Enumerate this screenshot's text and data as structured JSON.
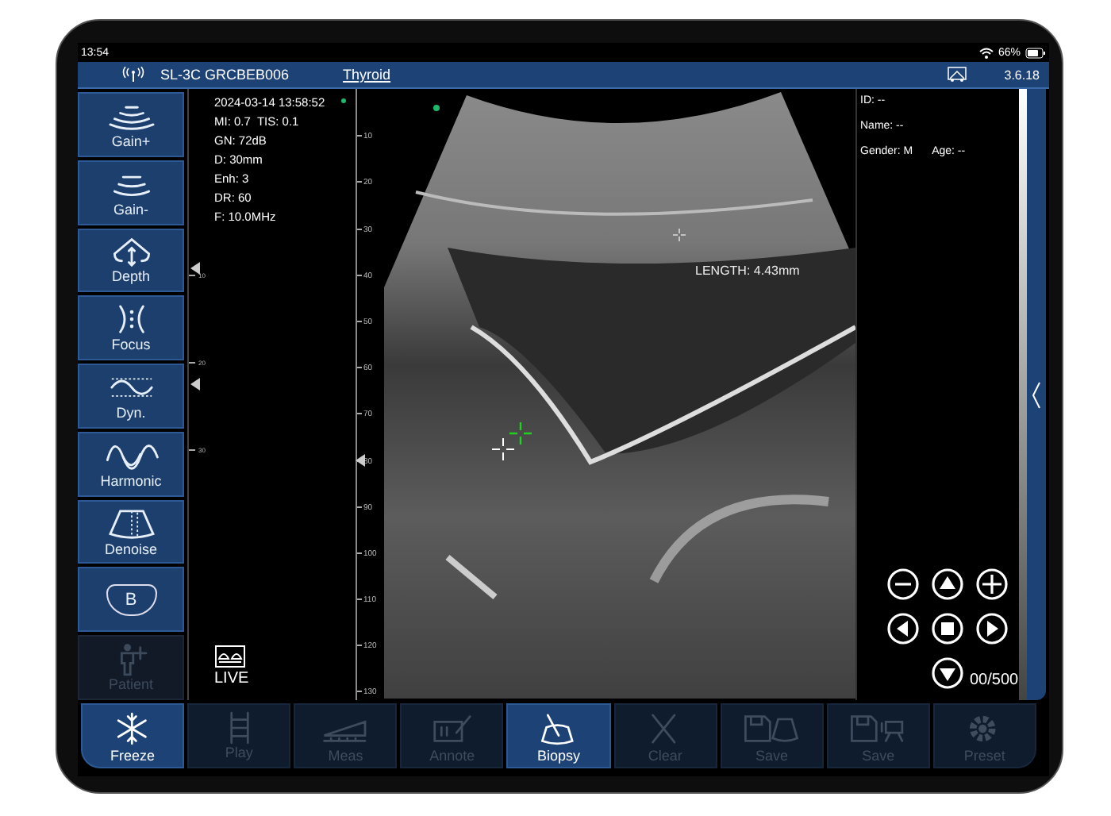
{
  "status_bar": {
    "time": "13:54",
    "battery": "66%"
  },
  "header": {
    "device": "SL-3C GRCBEB006",
    "preset": "Thyroid",
    "version": "3.6.18"
  },
  "sidebar": {
    "items": [
      {
        "kind": "gain_up",
        "label": "Gain+",
        "disabled": false
      },
      {
        "kind": "gain_down",
        "label": "Gain-",
        "disabled": false
      },
      {
        "kind": "depth",
        "label": "Depth",
        "disabled": false
      },
      {
        "kind": "focus",
        "label": "Focus",
        "disabled": false
      },
      {
        "kind": "dyn",
        "label": "Dyn.",
        "disabled": false
      },
      {
        "kind": "harmonic",
        "label": "Harmonic",
        "disabled": false
      },
      {
        "kind": "denoise",
        "label": "Denoise",
        "disabled": false
      },
      {
        "kind": "b_mode",
        "label": "B",
        "disabled": false
      },
      {
        "kind": "patient",
        "label": "Patient",
        "disabled": true
      }
    ]
  },
  "scan_info": [
    "2024-03-14 13:58:52",
    "MI: 0.7  TIS: 0.1",
    "GN: 72dB",
    "D: 30mm",
    "Enh: 3",
    "DR: 60",
    "F: 10.0MHz"
  ],
  "small_scale": [
    "10",
    "20",
    "30"
  ],
  "live_label": "LIVE",
  "depth_ruler": [
    "10",
    "20",
    "30",
    "40",
    "50",
    "60",
    "70",
    "80",
    "90",
    "100",
    "110",
    "120",
    "130"
  ],
  "measurement": "LENGTH: 4.43mm",
  "patient": [
    "ID: --",
    "Name: --",
    "Gender: M",
    "Age: --"
  ],
  "frame_counter": "00/500",
  "toolbar": [
    {
      "kind": "freeze",
      "label": "Freeze",
      "selected": true,
      "disabled": false
    },
    {
      "kind": "play",
      "label": "Play",
      "selected": false,
      "disabled": true
    },
    {
      "kind": "meas",
      "label": "Meas",
      "selected": false,
      "disabled": true
    },
    {
      "kind": "annote",
      "label": "Annote",
      "selected": false,
      "disabled": true
    },
    {
      "kind": "biopsy",
      "label": "Biopsy",
      "selected": true,
      "disabled": false
    },
    {
      "kind": "clear",
      "label": "Clear",
      "selected": false,
      "disabled": true
    },
    {
      "kind": "save_image",
      "label": "Save",
      "selected": false,
      "disabled": true
    },
    {
      "kind": "save_video",
      "label": "Save",
      "selected": false,
      "disabled": true
    },
    {
      "kind": "preset",
      "label": "Preset",
      "selected": false,
      "disabled": true
    }
  ]
}
